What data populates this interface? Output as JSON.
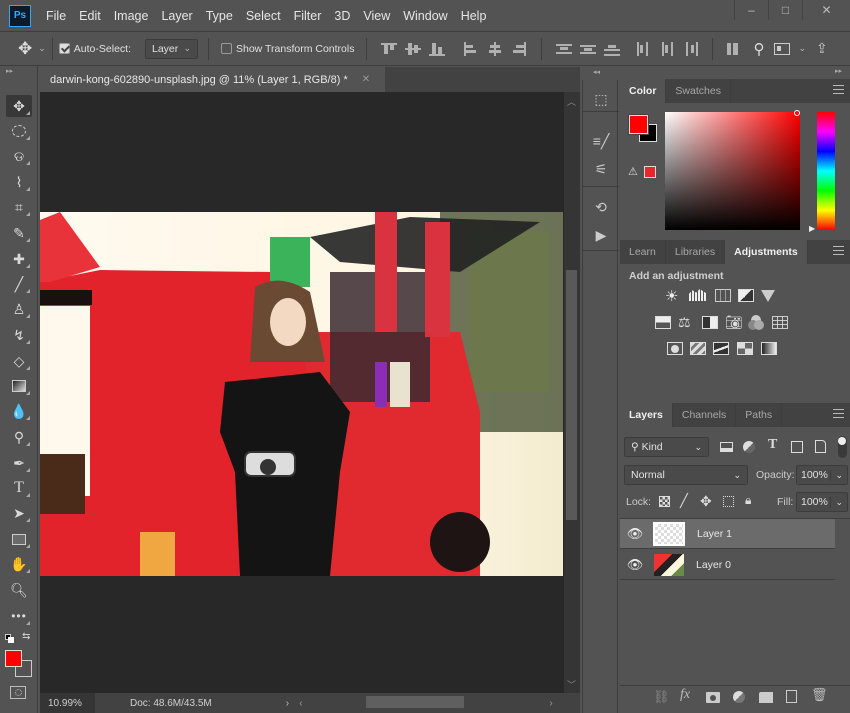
{
  "app": {
    "logo": "Ps"
  },
  "menu": [
    "File",
    "Edit",
    "Image",
    "Layer",
    "Type",
    "Select",
    "Filter",
    "3D",
    "View",
    "Window",
    "Help"
  ],
  "window_controls": {
    "minimize": "–",
    "maximize": "□",
    "close": "✕"
  },
  "options_bar": {
    "auto_select_label": "Auto-Select:",
    "auto_select_checked": true,
    "auto_select_target": "Layer",
    "show_transform_label": "Show Transform Controls",
    "show_transform_checked": false
  },
  "document_tab": {
    "title": "darwin-kong-602890-unsplash.jpg @ 11% (Layer 1, RGB/8) *",
    "close": "✕"
  },
  "tools": [
    "move",
    "rectangular-marquee",
    "lasso",
    "quick-selection",
    "crop",
    "eyedropper",
    "spot-healing-brush",
    "brush",
    "clone-stamp",
    "history-brush",
    "eraser",
    "gradient",
    "blur",
    "dodge",
    "pen",
    "type",
    "path-selection",
    "rectangle",
    "hand",
    "zoom",
    "edit-toolbar"
  ],
  "colors": {
    "foreground": "#ff0000",
    "background": "#000000",
    "accent": "#31a8ff"
  },
  "status_bar": {
    "zoom": "10.99%",
    "doc_size": "Doc: 48.6M/43.5M"
  },
  "color_panel": {
    "tabs": [
      "Color",
      "Swatches"
    ],
    "active_tab": "Color",
    "hue_color": "#ff0000",
    "gamut_warning_swatch": "#e8272a"
  },
  "adjustments_panel": {
    "tabs": [
      "Learn",
      "Libraries",
      "Adjustments"
    ],
    "active_tab": "Adjustments",
    "heading": "Add an adjustment",
    "rows": [
      [
        "brightness-contrast",
        "levels",
        "curves",
        "exposure",
        "vibrance"
      ],
      [
        "hue-saturation",
        "color-balance",
        "black-white",
        "photo-filter",
        "channel-mixer",
        "color-lookup"
      ],
      [
        "invert",
        "posterize",
        "threshold",
        "selective-color",
        "gradient-map"
      ]
    ]
  },
  "layers_panel": {
    "tabs": [
      "Layers",
      "Channels",
      "Paths"
    ],
    "active_tab": "Layers",
    "filter_kind": "Kind",
    "blend_mode": "Normal",
    "opacity_label": "Opacity:",
    "opacity": "100%",
    "lock_label": "Lock:",
    "fill_label": "Fill:",
    "fill": "100%",
    "layers": [
      {
        "name": "Layer 1",
        "visible": true,
        "selected": true
      },
      {
        "name": "Layer 0",
        "visible": true,
        "selected": false
      }
    ]
  }
}
